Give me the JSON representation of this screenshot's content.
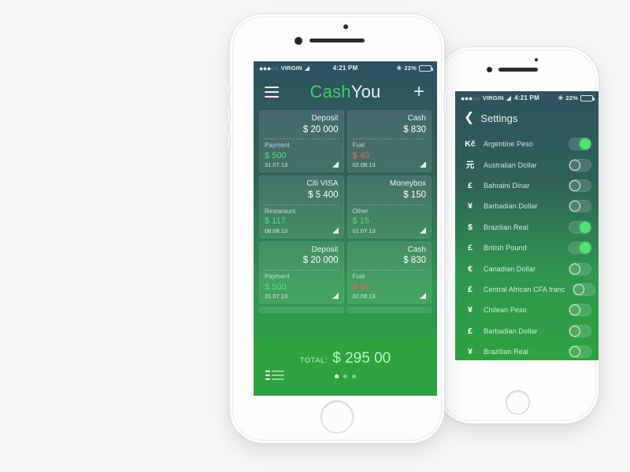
{
  "canvas": {
    "background": "#f7f7f7"
  },
  "theme": {
    "screen_gradient_top": "#2e5261",
    "screen_gradient_bottom": "#2ea23f",
    "accent_green": "#41d163",
    "amount_positive": "#4fe07a",
    "amount_negative": "#ef6055",
    "total_green": "#b8f5c4",
    "toggle_on": "#4fe46f"
  },
  "status_bar": {
    "signal_dots_filled": 3,
    "signal_dots_hollow": 2,
    "carrier": "VIRGIN",
    "wifi_icon": "wifi-icon",
    "time": "4:21 PM",
    "bluetooth_icon": "bluetooth-icon",
    "battery_percent": "22%",
    "battery_icon": "battery-icon",
    "battery_level": 22
  },
  "left_phone": {
    "hardware": {
      "speaker_name": "earpiece-speaker",
      "camera_name": "front-camera",
      "home_button_name": "home-button"
    },
    "navbar": {
      "menu_icon": "hamburger-menu-icon",
      "title_part_1": "Cash",
      "title_part_2": "You",
      "add_icon": "plus-icon"
    },
    "cards": [
      {
        "name": "Deposit",
        "balance": "$ 20 000",
        "category": "Payment",
        "amount": "$ 500",
        "amount_sign": "pos",
        "date": "31.07.13",
        "corner_icon": "fold-corner-icon"
      },
      {
        "name": "Cash",
        "balance": "$ 830",
        "category": "Fuel",
        "amount": "$ 40",
        "amount_sign": "neg",
        "date": "02.08.13",
        "corner_icon": "fold-corner-icon"
      },
      {
        "name": "Citi VISA",
        "balance": "$ 5 400",
        "category": "Restaraunt",
        "amount": "$ 117",
        "amount_sign": "pos",
        "date": "08.08.13",
        "corner_icon": "fold-corner-icon"
      },
      {
        "name": "Moneybox",
        "balance": "$ 150",
        "category": "Other",
        "amount": "$ 15",
        "amount_sign": "pos",
        "date": "01.07.13",
        "corner_icon": "fold-corner-icon"
      },
      {
        "name": "Deposit",
        "balance": "$ 20 000",
        "category": "Payment",
        "amount": "$ 500",
        "amount_sign": "pos",
        "date": "31.07.13",
        "corner_icon": "fold-corner-icon"
      },
      {
        "name": "Cash",
        "balance": "$ 830",
        "category": "Fuel",
        "amount": "$ 40",
        "amount_sign": "neg",
        "date": "02.08.13",
        "corner_icon": "fold-corner-icon"
      }
    ],
    "total_bar": {
      "label": "TOTAL:",
      "value": "$ 295 00",
      "list_view_icon": "list-view-icon",
      "page_dots": 3,
      "page_active_index": 0
    }
  },
  "right_phone": {
    "navbar": {
      "back_icon": "chevron-left-icon",
      "title": "Settings"
    },
    "currencies": [
      {
        "symbol": "Kč",
        "name": "Argentine Peso",
        "enabled": true
      },
      {
        "symbol": "元",
        "name": "Australian Dollar",
        "enabled": false
      },
      {
        "symbol": "£",
        "name": "Bahraini Dinar",
        "enabled": false
      },
      {
        "symbol": "¥",
        "name": "Barbadian Dollar",
        "enabled": false
      },
      {
        "symbol": "$",
        "name": "Brazilian Real",
        "enabled": true
      },
      {
        "symbol": "£",
        "name": "British Pound",
        "enabled": true
      },
      {
        "symbol": "€",
        "name": "Canadian Dollar",
        "enabled": false
      },
      {
        "symbol": "£",
        "name": "Central African CFA franc",
        "enabled": false
      },
      {
        "symbol": "¥",
        "name": "Chilean Peso",
        "enabled": false
      },
      {
        "symbol": "£",
        "name": "Barbadian Dollar",
        "enabled": false
      },
      {
        "symbol": "¥",
        "name": "Brazilian Real",
        "enabled": false
      }
    ]
  }
}
